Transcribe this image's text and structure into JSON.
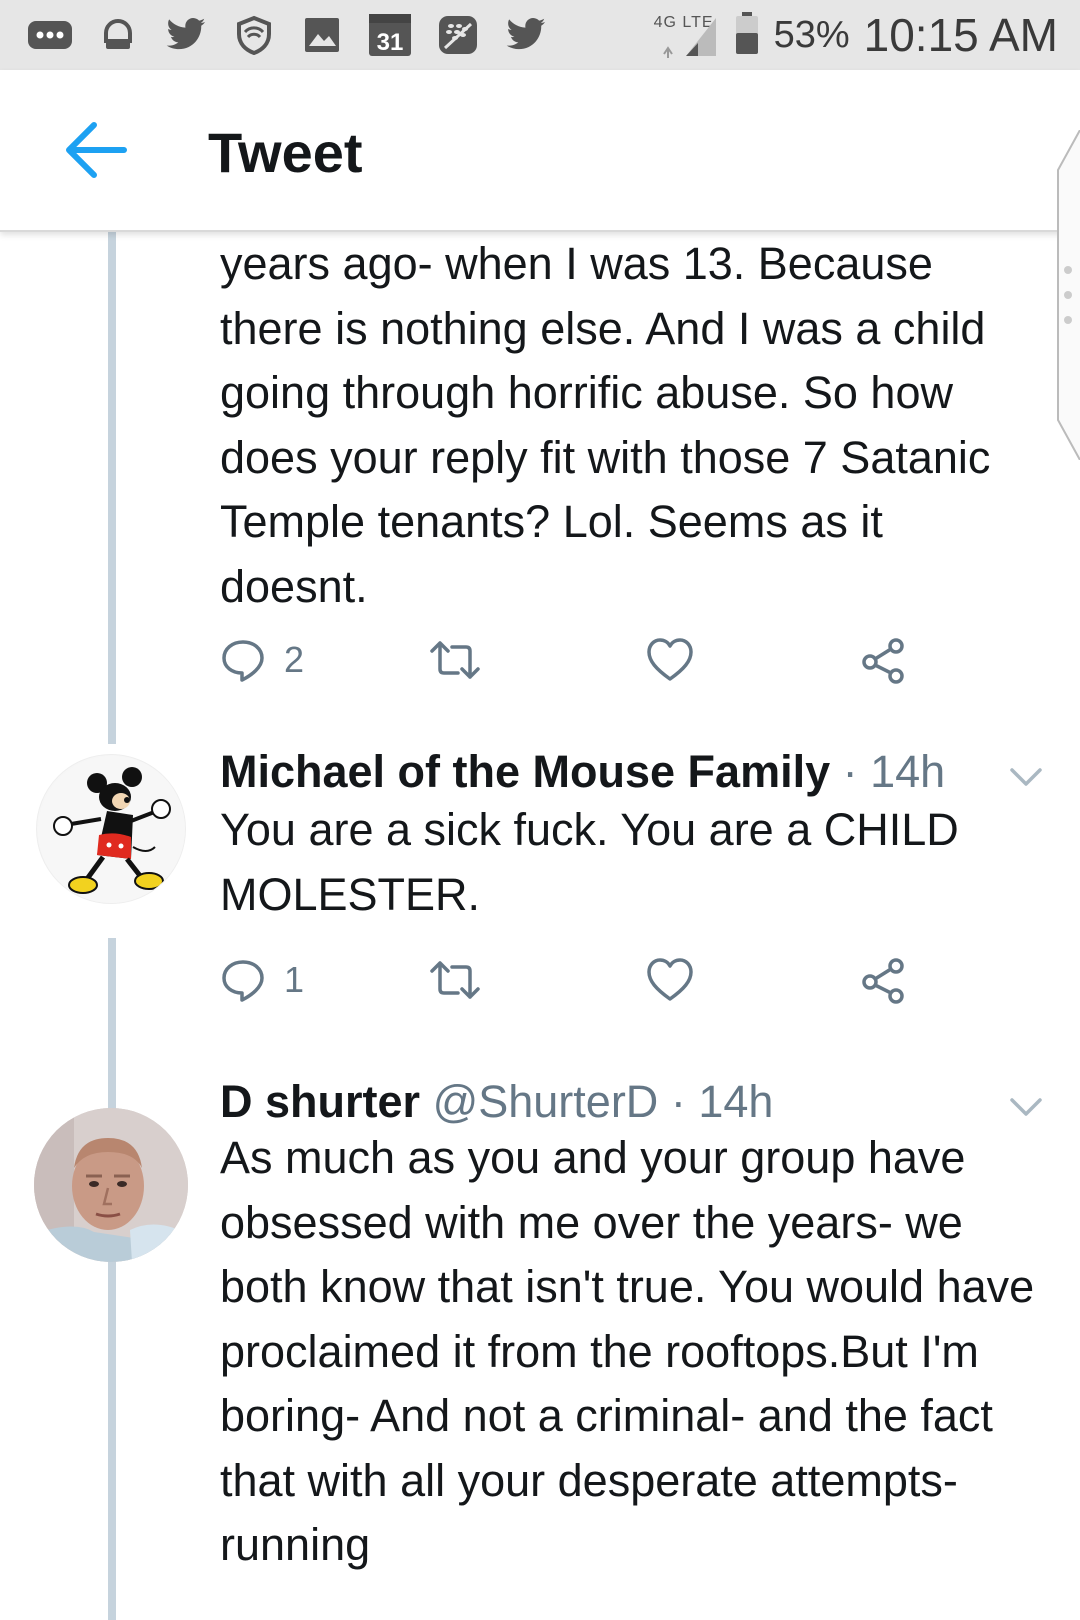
{
  "status_bar": {
    "icons": [
      "more-notifications-icon",
      "voicemail-icon",
      "twitter-icon",
      "vpn-shield-icon",
      "gallery-icon",
      "calendar-icon",
      "blackberry-icon",
      "twitter-icon"
    ],
    "calendar_day": "31",
    "network": "4G LTE",
    "battery_percent": "53%",
    "time": "10:15 AM"
  },
  "header": {
    "title": "Tweet"
  },
  "tweets": [
    {
      "text": "years ago- when I was 13. Because there is nothing else. And I was a child going through horrific abuse. So how does your reply fit with those 7 Satanic Temple tenants? Lol. Seems as it doesnt.",
      "reply_count": "2"
    },
    {
      "name": "Michael of the Mouse Family",
      "handle": "",
      "time": "· 14h",
      "text": "You are a sick fuck. You are a CHILD MOLESTER.",
      "reply_count": "1"
    },
    {
      "name": "D shurter",
      "handle": "@ShurterD",
      "time": "· 14h",
      "text": "As much as you and your group have obsessed with me over the years- we both know that isn't true. You would have proclaimed it from the rooftops.But I'm boring- And not a criminal- and the fact that with all your desperate attempts- running"
    }
  ],
  "colors": {
    "accent": "#1da1f2",
    "meta": "#657786",
    "thread_line": "#c6d3dd",
    "status_bar_bg": "#e6e6e6"
  }
}
